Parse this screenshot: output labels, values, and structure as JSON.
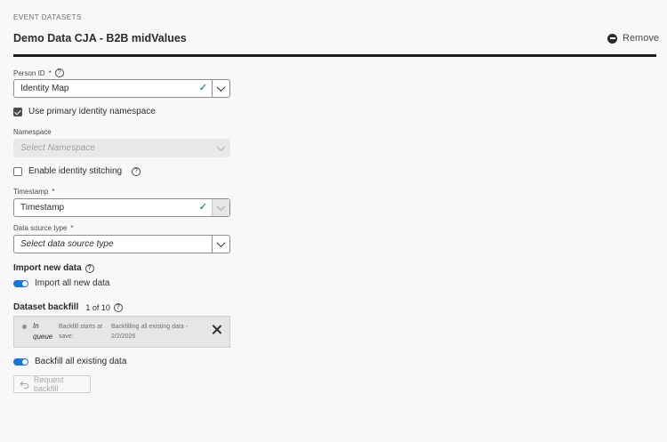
{
  "header": {
    "section_label": "EVENT DATASETS",
    "dataset_title": "Demo Data CJA - B2B midValues",
    "remove_label": "Remove"
  },
  "person_id": {
    "label": "Person ID",
    "required": "*",
    "value": "Identity Map"
  },
  "use_primary_identity": {
    "label": "Use primary identity namespace",
    "checked": true
  },
  "namespace": {
    "label": "Namespace",
    "placeholder": "Select Namespace",
    "disabled": true
  },
  "identity_stitching": {
    "label": "Enable identity stitching",
    "checked": false
  },
  "timestamp": {
    "label": "Timestamp",
    "required": "*",
    "value": "Timestamp"
  },
  "data_source_type": {
    "label": "Data source type",
    "required": "*",
    "placeholder": "Select data source type"
  },
  "import_new_data": {
    "heading": "Import new data",
    "toggle_label": "Import all new data",
    "enabled": true
  },
  "dataset_backfill": {
    "heading": "Dataset backfill",
    "count": "1 of 10",
    "item": {
      "status": "In queue",
      "start_text": "Backfill starts at save:",
      "range_text": "Backfilling all existing data - 2/2/2026"
    },
    "toggle_label": "Backfill all existing data",
    "enabled": true,
    "request_button": "Request backfill"
  },
  "colors": {
    "accent_blue": "#1473e6",
    "valid_green": "#2d9d78"
  }
}
